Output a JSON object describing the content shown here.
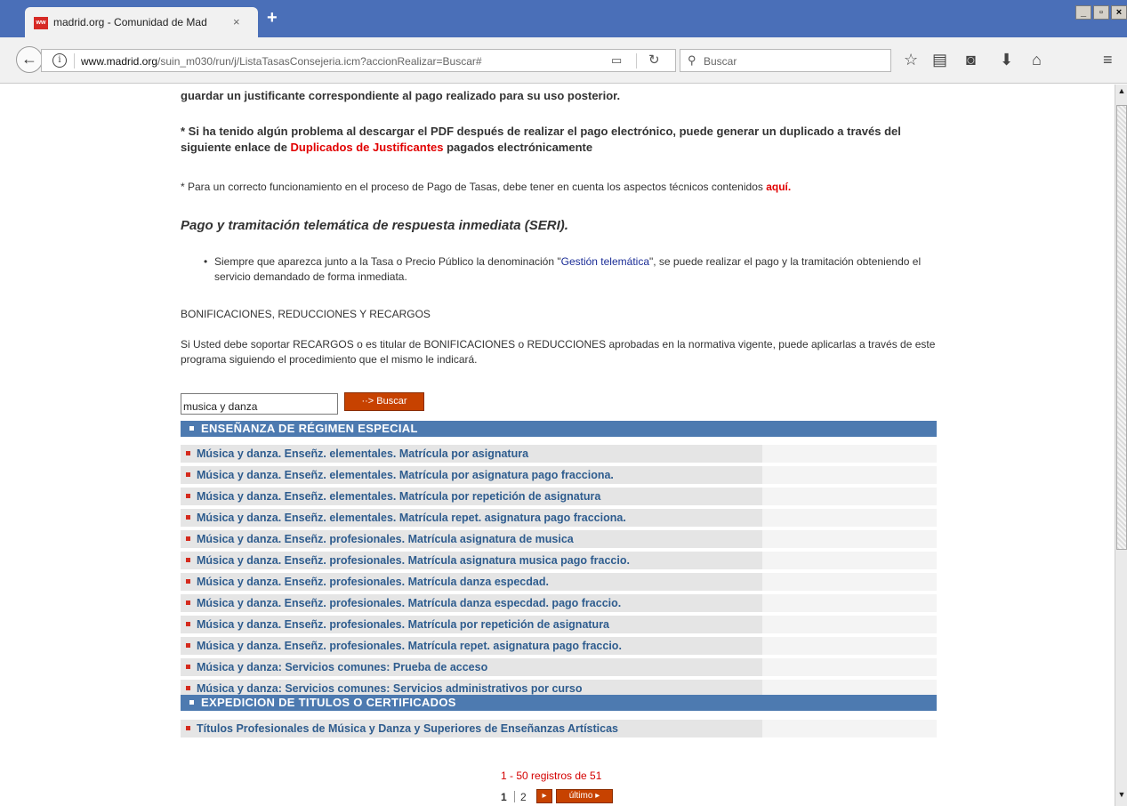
{
  "browser": {
    "tab_title": "madrid.org - Comunidad de Mad",
    "tab_favicon_text": "ww",
    "tab_close": "×",
    "new_tab": "+",
    "url_host": "www.madrid.org",
    "url_path": "/suin_m030/run/j/ListaTasasConsejeria.icm?accionRealizar=Buscar#",
    "search_placeholder": "Buscar",
    "win_min": "_",
    "win_max": "▫",
    "win_close": "×",
    "icons": [
      "back-arrow-icon",
      "info-icon",
      "reader-view-icon",
      "reload-icon",
      "search-icon",
      "bookmark-star-icon",
      "library-icon",
      "pocket-icon",
      "download-icon",
      "home-icon",
      "menu-icon"
    ]
  },
  "page": {
    "intro_tail": "guardar un justificante correspondiente al pago realizado para su uso posterior.",
    "duplicate_pre": "* Si ha tenido algún problema al descargar el PDF después de realizar el pago electrónico, puede generar un duplicado a través del siguiente enlace de ",
    "duplicate_link": "Duplicados de Justificantes",
    "duplicate_post": " pagados electrónicamente",
    "tech_pre": "* Para un correcto funcionamiento en el proceso de Pago de Tasas, debe tener en cuenta los aspectos técnicos contenidos ",
    "tech_link": "aquí.",
    "seri_heading": "Pago y tramitación telemática de respuesta inmediata (SERI).",
    "bullet_pre": "Siempre que aparezca junto a la Tasa o Precio Público la denominación \"",
    "bullet_link": "Gestión telemática",
    "bullet_post": "\", se puede realizar el pago y la tramitación obteniendo el servicio demandado de forma inmediata.",
    "bonif_heading": "BONIFICACIONES, REDUCCIONES Y RECARGOS",
    "bonif_text": "Si Usted debe soportar RECARGOS o es titular de BONIFICACIONES o REDUCCIONES aprobadas en la normativa vigente, puede aplicarlas a través de este programa siguiendo el procedimiento que el mismo le indicará.",
    "search_value": "musica y danza",
    "search_button": "··> Buscar"
  },
  "categories": [
    {
      "title": "ENSEÑANZA DE RÉGIMEN ESPECIAL",
      "items": [
        "Música y danza. Enseñz. elementales. Matrícula por asignatura",
        "Música y danza. Enseñz. elementales. Matrícula por asignatura pago fracciona.",
        "Música y danza. Enseñz. elementales. Matrícula por repetición de asignatura",
        "Música y danza. Enseñz. elementales. Matrícula repet. asignatura pago fracciona.",
        "Música y danza. Enseñz. profesionales. Matrícula asignatura de musica",
        "Música y danza. Enseñz. profesionales. Matrícula asignatura musica pago fraccio.",
        "Música y danza. Enseñz. profesionales. Matrícula danza especdad.",
        "Música y danza. Enseñz. profesionales. Matrícula danza especdad. pago fraccio.",
        "Música y danza. Enseñz. profesionales. Matrícula por repetición de asignatura",
        "Música y danza. Enseñz. profesionales. Matrícula repet. asignatura pago fraccio.",
        "Música y danza: Servicios comunes: Prueba de acceso",
        "Música y danza: Servicios comunes: Servicios administrativos por curso"
      ]
    },
    {
      "title": "EXPEDICION DE TITULOS O CERTIFICADOS",
      "items": [
        "Títulos Profesionales de Música y Danza y Superiores de Enseñanzas Artísticas"
      ]
    }
  ],
  "pagination": {
    "info": "1 - 50 registros de 51",
    "current": "1",
    "next_page": "2",
    "next_btn": "▸",
    "last_btn": "último ▸"
  }
}
